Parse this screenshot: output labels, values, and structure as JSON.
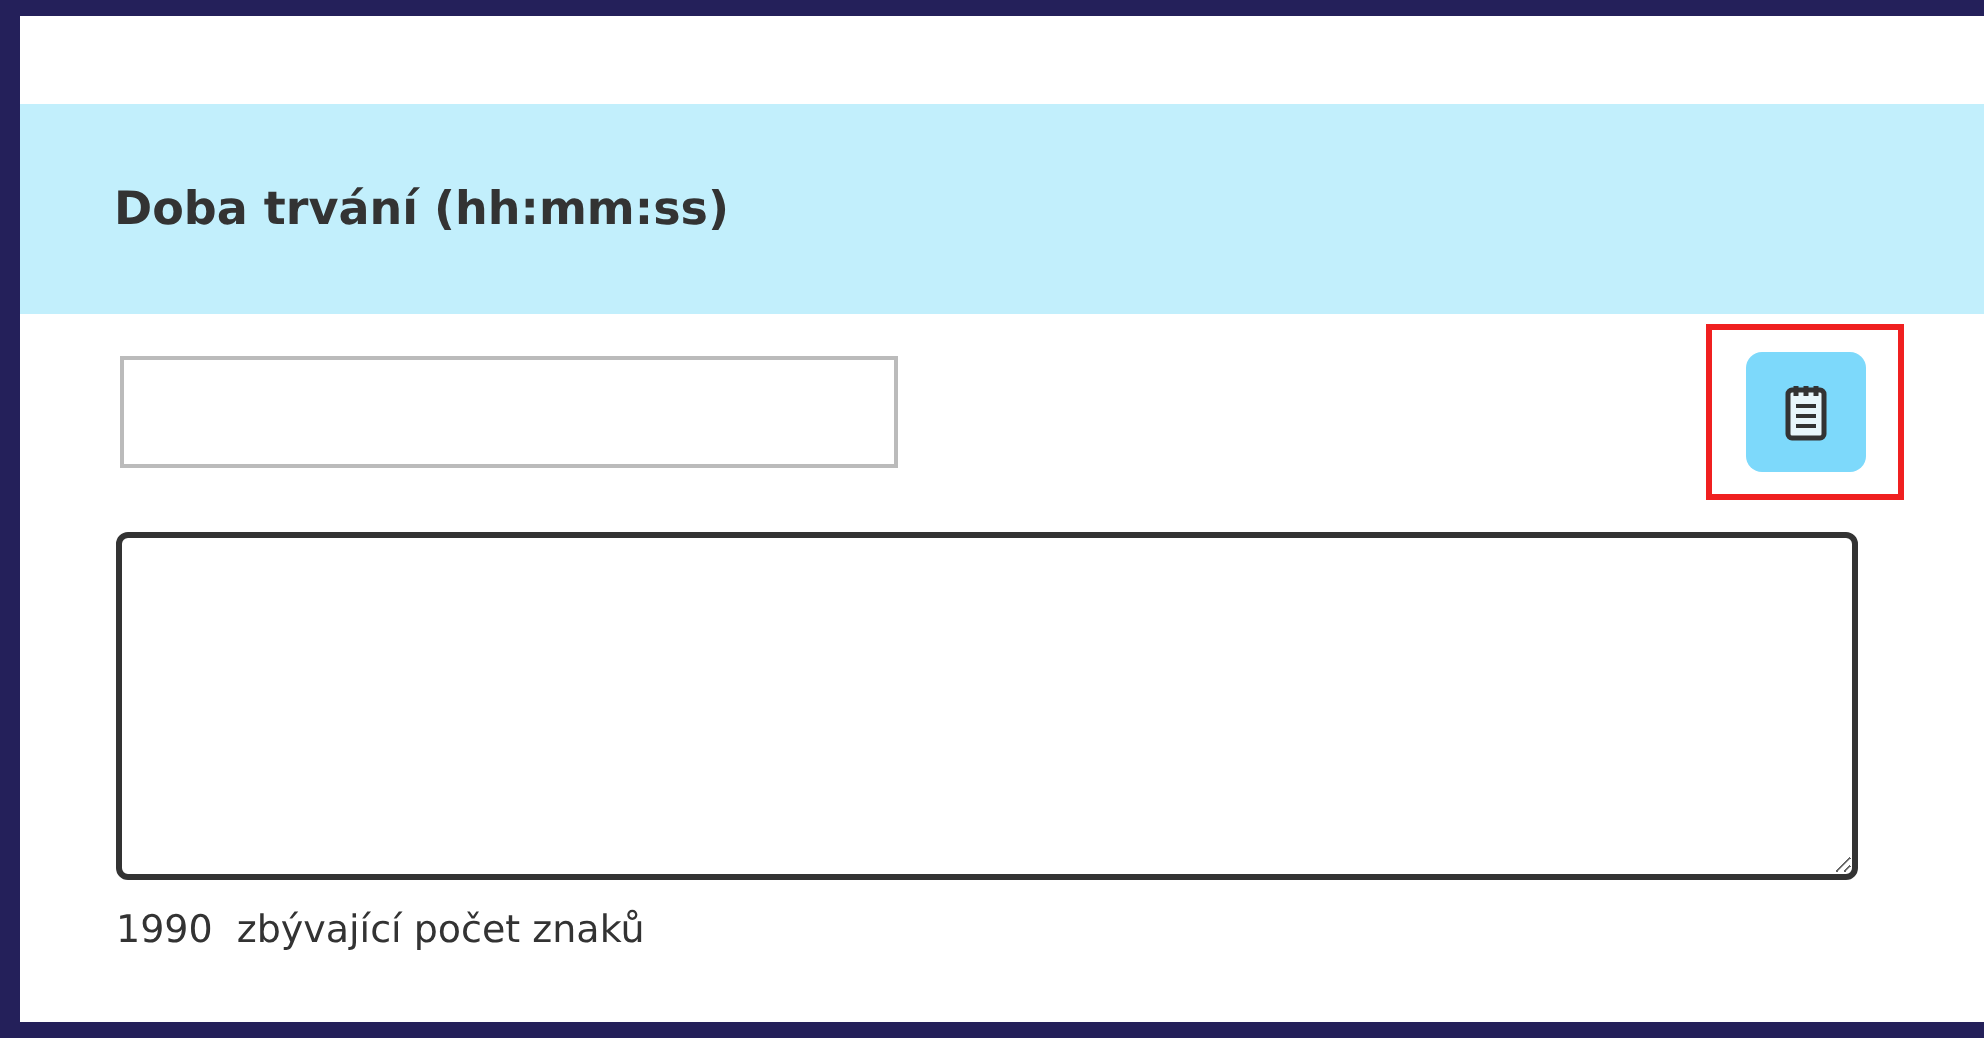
{
  "section": {
    "title": "Doba trvání (hh:mm:ss)"
  },
  "clipboard_button": {
    "highlighted": true
  },
  "counter": {
    "count": "1990",
    "label": "zbývající počet znaků"
  }
}
